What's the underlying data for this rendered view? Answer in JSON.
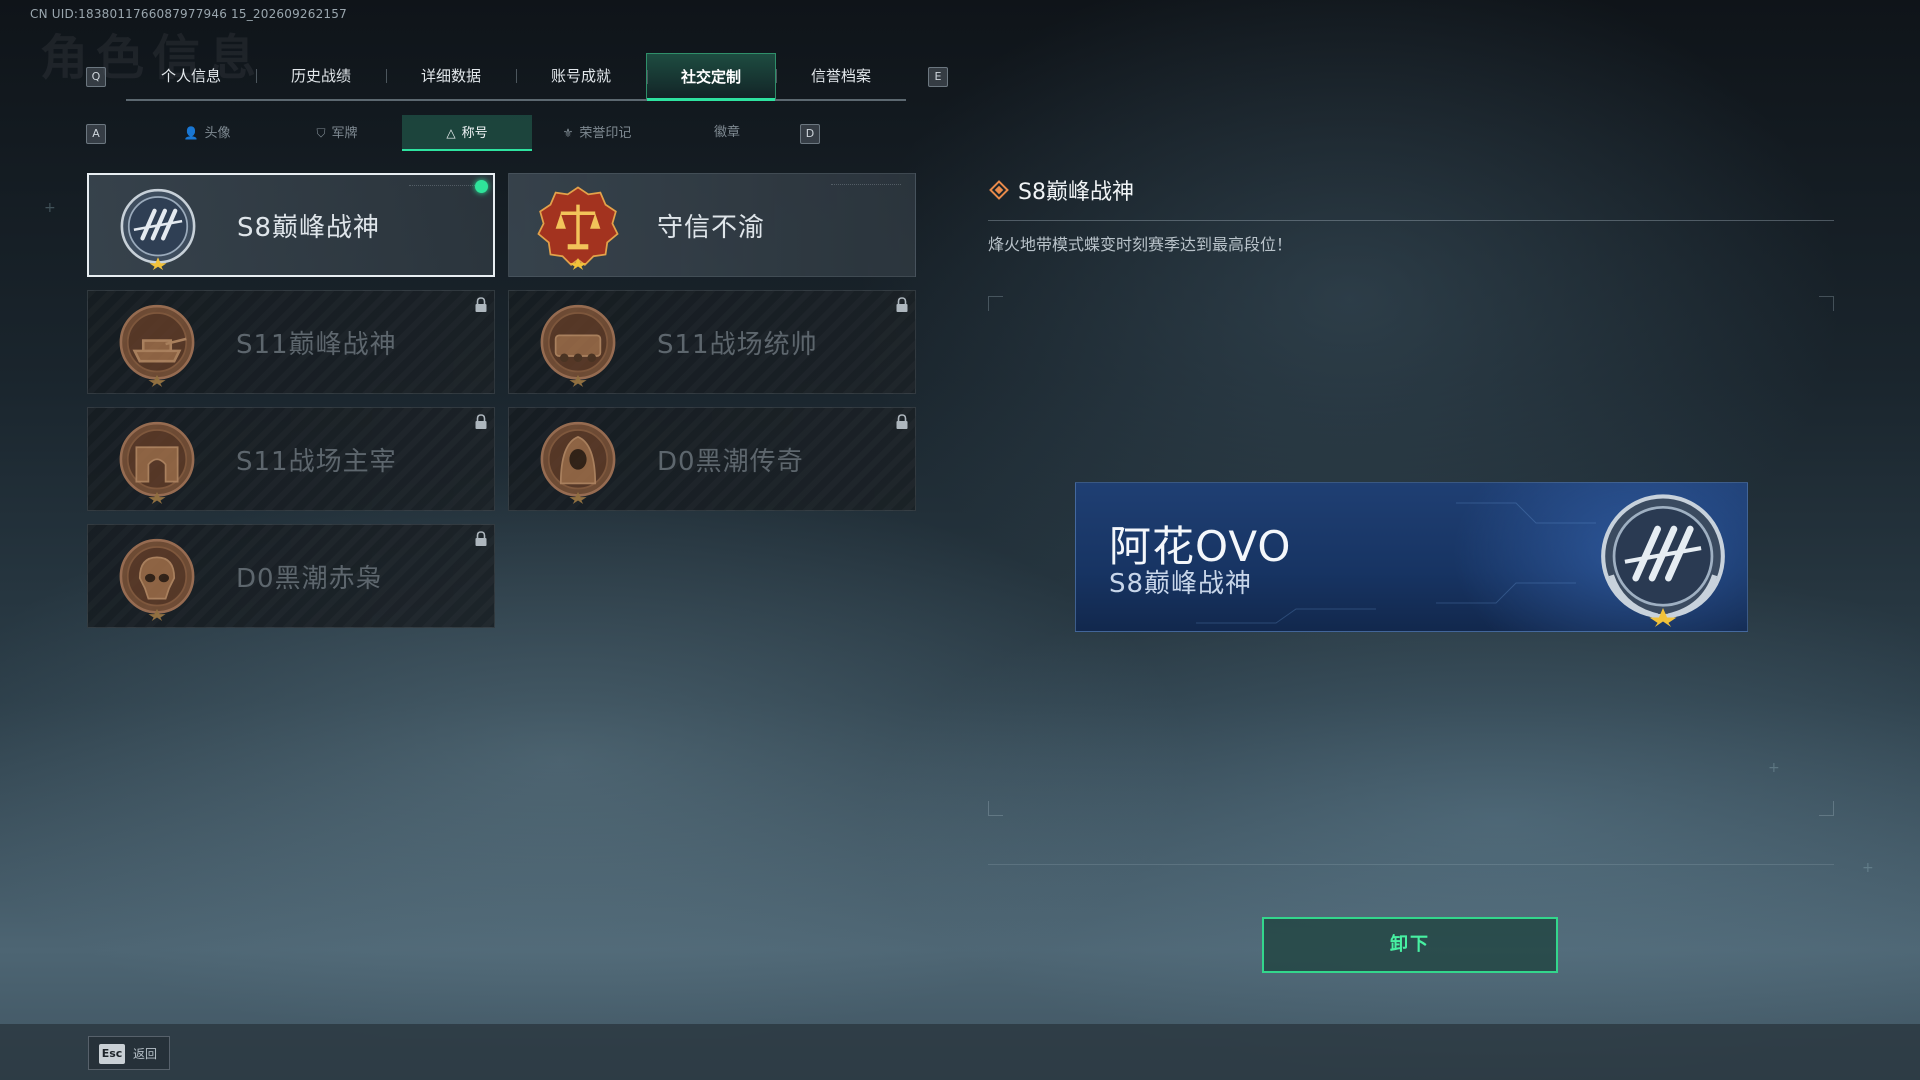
{
  "uid_text": "CN UID:1838011766087977946 15_202609262157",
  "tabbar": {
    "left_key": "Q",
    "right_key": "E",
    "tabs": [
      "个人信息",
      "历史战绩",
      "详细数据",
      "账号成就",
      "社交定制",
      "信誉档案"
    ],
    "active_index": 4
  },
  "subbar": {
    "left_key": "A",
    "right_key": "D",
    "tabs": [
      "头像",
      "军牌",
      "称号",
      "荣誉印记",
      "徽章"
    ],
    "active_index": 2
  },
  "titles": [
    {
      "label": "S8巅峰战神",
      "locked": false,
      "selected": true,
      "equipped": true,
      "medal": "wings-emblem-icon"
    },
    {
      "label": "守信不渝",
      "locked": false,
      "selected": false,
      "equipped": false,
      "medal": "scales-emblem-icon"
    },
    {
      "label": "S11巅峰战神",
      "locked": true,
      "selected": false,
      "equipped": false,
      "medal": "tank-emblem-icon"
    },
    {
      "label": "S11战场统帅",
      "locked": true,
      "selected": false,
      "equipped": false,
      "medal": "apc-emblem-icon"
    },
    {
      "label": "S11战场主宰",
      "locked": true,
      "selected": false,
      "equipped": false,
      "medal": "arch-emblem-icon"
    },
    {
      "label": "D0黑潮传奇",
      "locked": true,
      "selected": false,
      "equipped": false,
      "medal": "hooded-figure-emblem-icon"
    },
    {
      "label": "D0黑潮赤枭",
      "locked": true,
      "selected": false,
      "equipped": false,
      "medal": "skull-emblem-icon"
    }
  ],
  "detail": {
    "name": "S8巅峰战神",
    "description": "烽火地带模式蝶变时刻赛季达到最高段位！"
  },
  "preview": {
    "player_name": "阿花OVO",
    "title": "S8巅峰战神"
  },
  "unequip_label": "卸下",
  "esc": {
    "key": "Esc",
    "label": "返回"
  },
  "colors": {
    "accent": "#2ee3a0",
    "plate_bg": "#1a3766",
    "locked_text": "#5d666d"
  }
}
